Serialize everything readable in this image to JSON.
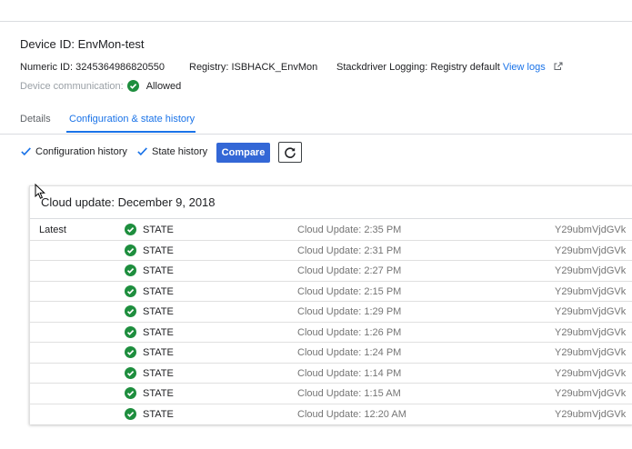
{
  "device": {
    "title": "Device ID: EnvMon-test",
    "numeric_id": "Numeric ID: 3245364986820550",
    "registry": "Registry: ISBHACK_EnvMon",
    "logging_label": "Stackdriver Logging: Registry default",
    "logging_link": "View logs",
    "communication_label": "Device communication:",
    "communication_status": "Allowed"
  },
  "tabs": [
    {
      "label": "Details",
      "active": false
    },
    {
      "label": "Configuration & state history",
      "active": true
    }
  ],
  "filters": {
    "config_history": {
      "label": "Configuration history",
      "checked": true
    },
    "state_history": {
      "label": "State history",
      "checked": true
    }
  },
  "toolbar": {
    "compare_label": "Compare",
    "refresh_icon": "refresh-icon"
  },
  "history": {
    "title": "Cloud update: December 9, 2018",
    "rows": [
      {
        "latest": "Latest",
        "type": "STATE",
        "time": "Cloud Update: 2:35 PM",
        "version": "Y29ubmVjdGVk"
      },
      {
        "latest": "",
        "type": "STATE",
        "time": "Cloud Update: 2:31 PM",
        "version": "Y29ubmVjdGVk"
      },
      {
        "latest": "",
        "type": "STATE",
        "time": "Cloud Update: 2:27 PM",
        "version": "Y29ubmVjdGVk"
      },
      {
        "latest": "",
        "type": "STATE",
        "time": "Cloud Update: 2:15 PM",
        "version": "Y29ubmVjdGVk"
      },
      {
        "latest": "",
        "type": "STATE",
        "time": "Cloud Update: 1:29 PM",
        "version": "Y29ubmVjdGVk"
      },
      {
        "latest": "",
        "type": "STATE",
        "time": "Cloud Update: 1:26 PM",
        "version": "Y29ubmVjdGVk"
      },
      {
        "latest": "",
        "type": "STATE",
        "time": "Cloud Update: 1:24 PM",
        "version": "Y29ubmVjdGVk"
      },
      {
        "latest": "",
        "type": "STATE",
        "time": "Cloud Update: 1:14 PM",
        "version": "Y29ubmVjdGVk"
      },
      {
        "latest": "",
        "type": "STATE",
        "time": "Cloud Update: 1:15 AM",
        "version": "Y29ubmVjdGVk"
      },
      {
        "latest": "",
        "type": "STATE",
        "time": "Cloud Update: 12:20 AM",
        "version": "Y29ubmVjdGVk"
      }
    ]
  },
  "colors": {
    "accent": "#1a73e8",
    "button": "#3367d6",
    "status_green": "#1e8e3e",
    "checkbox": "#1a73e8"
  }
}
